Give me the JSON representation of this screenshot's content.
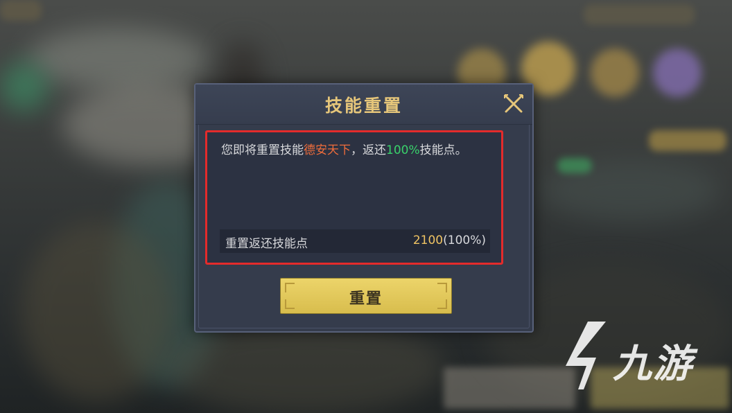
{
  "dialog": {
    "title": "技能重置",
    "description": {
      "prefix": "您即将重置技能",
      "skill_name": "德安天下",
      "middle": "，返还",
      "percent": "100%",
      "suffix": "技能点。"
    },
    "refund_row": {
      "label": "重置返还技能点",
      "value": "2100",
      "value_pct": "(100%)"
    },
    "reset_button_label": "重置",
    "close_icon": "close-x-icon"
  },
  "watermark": {
    "text": "九游",
    "logo_icon": "jiuyou-logo-icon"
  },
  "colors": {
    "title_gold": "#e6c67a",
    "skill_name_orange": "#f06d3b",
    "percent_green": "#39d26b",
    "highlight_border_red": "#e42b2b",
    "button_yellow": "#ecd46a",
    "dialog_bg": "#353c4c"
  }
}
